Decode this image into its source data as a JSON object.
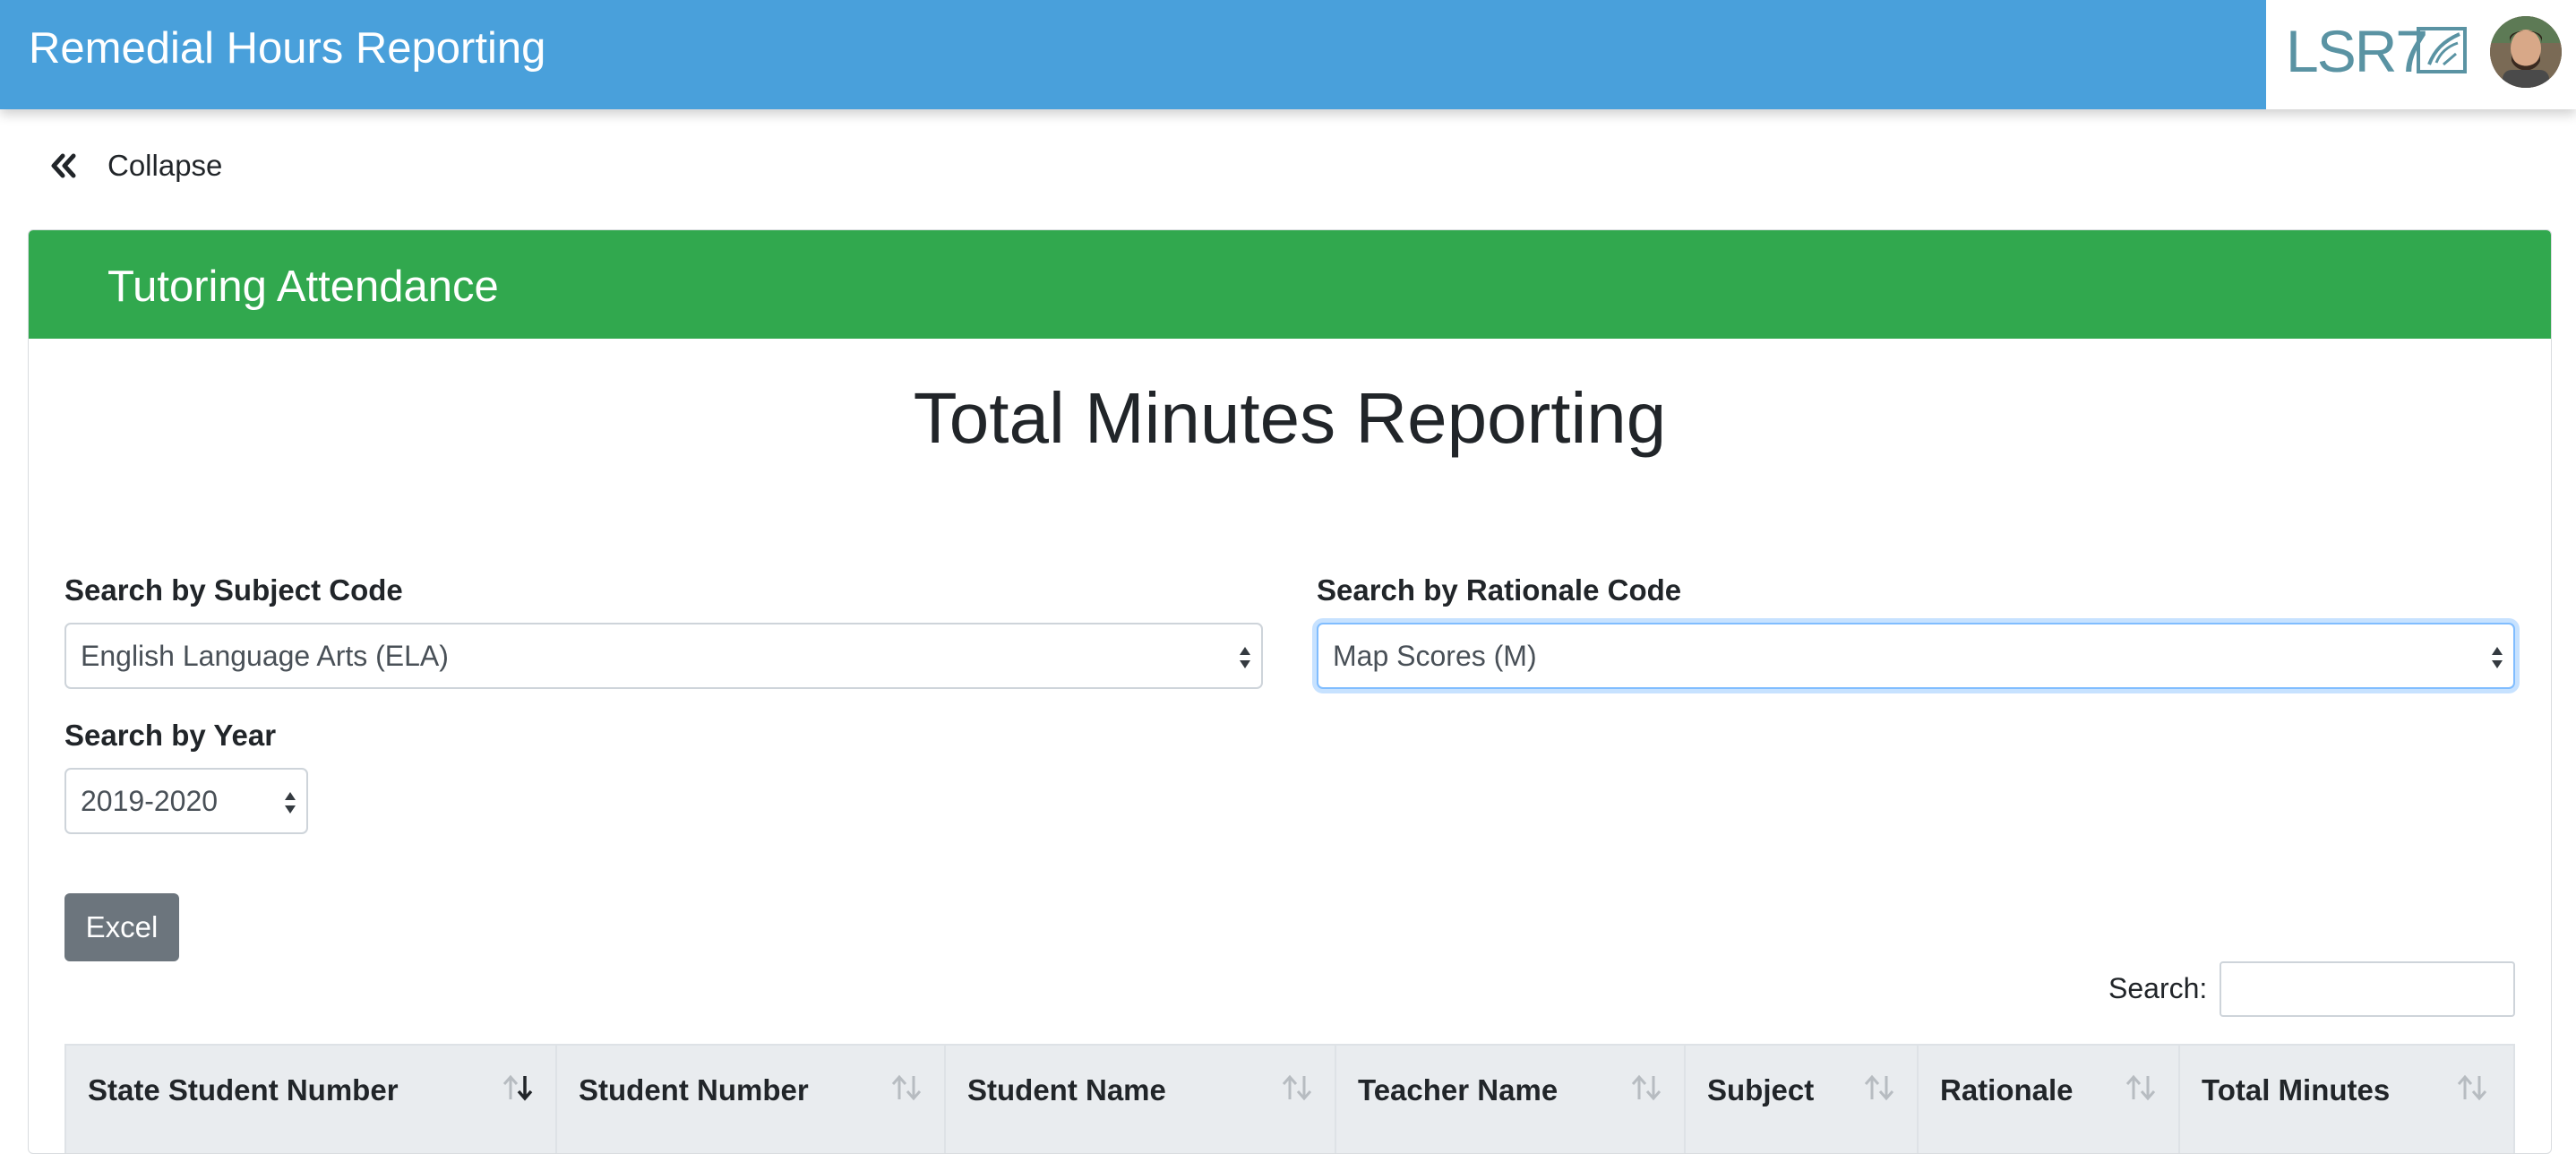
{
  "header": {
    "app_title": "Remedial Hours Reporting",
    "brand_logo_text": "LSR7",
    "colors": {
      "bar": "#49a0db",
      "brand": "#5a93a3"
    }
  },
  "sidebar_toggle": {
    "label": "Collapse",
    "icon": "double-chevron-left-icon"
  },
  "card": {
    "title": "Tutoring Attendance",
    "header_color": "#31a84e",
    "heading": "Total Minutes Reporting"
  },
  "filters": {
    "subject": {
      "label": "Search by Subject Code",
      "value": "English Language Arts (ELA)"
    },
    "rationale": {
      "label": "Search by Rationale Code",
      "value": "Map Scores (M)"
    },
    "year": {
      "label": "Search by Year",
      "value": "2019-2020"
    }
  },
  "toolbar": {
    "excel_label": "Excel"
  },
  "table_search": {
    "label": "Search:",
    "value": ""
  },
  "table": {
    "columns": [
      {
        "label": "State Student Number",
        "sort": "descending"
      },
      {
        "label": "Student Number",
        "sort": "none"
      },
      {
        "label": "Student Name",
        "sort": "none"
      },
      {
        "label": "Teacher Name",
        "sort": "none"
      },
      {
        "label": "Subject",
        "sort": "none"
      },
      {
        "label": "Rationale",
        "sort": "none"
      },
      {
        "label": "Total Minutes",
        "sort": "none"
      }
    ]
  }
}
